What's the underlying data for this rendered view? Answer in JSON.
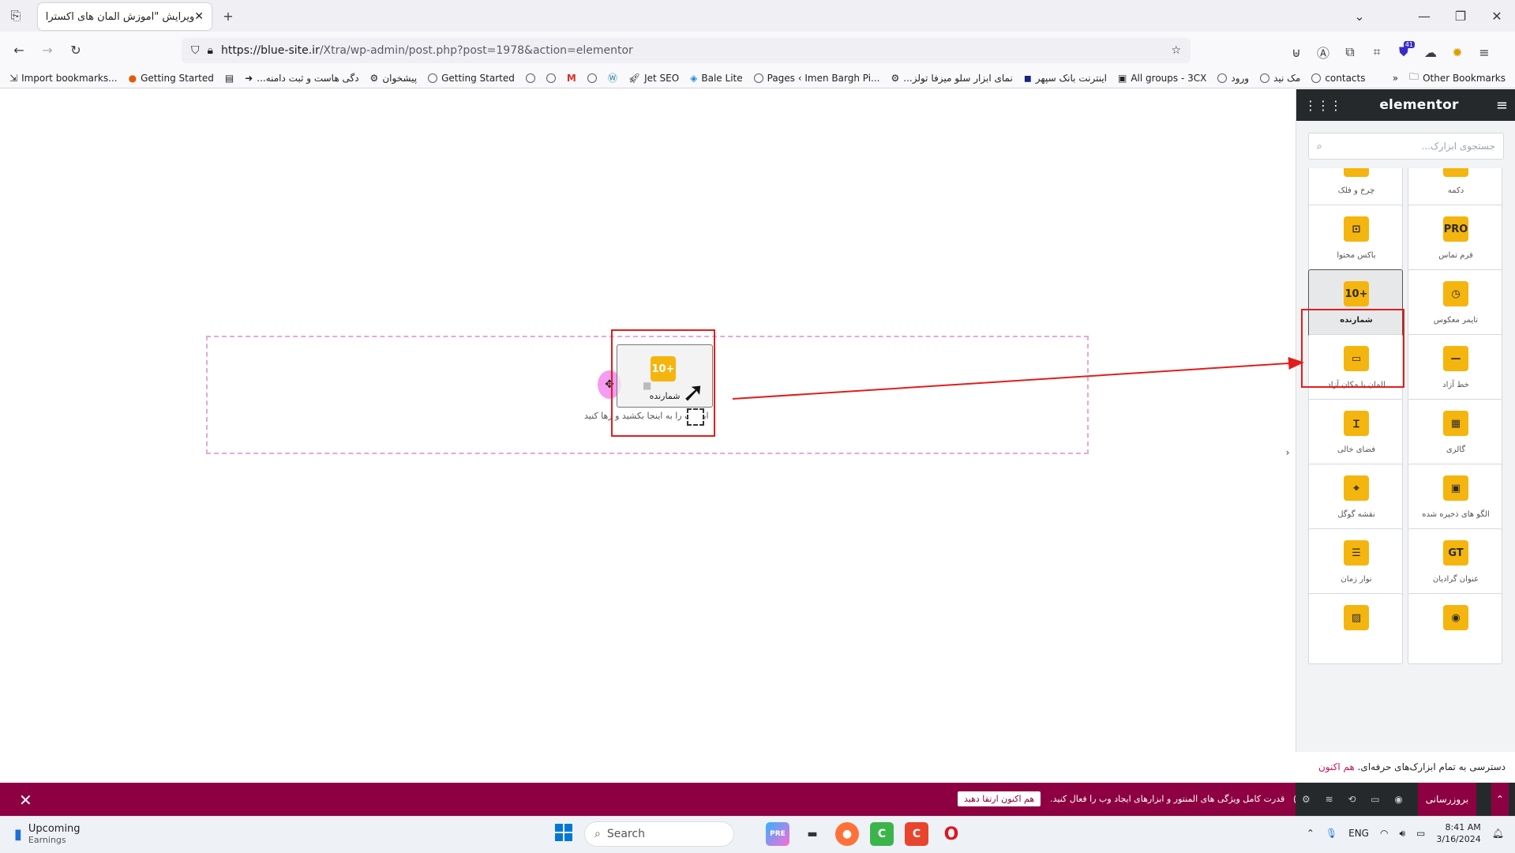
{
  "browser": {
    "tab_title": "ویرایش \"آموزش المان های اکسترا – ...",
    "url_host": "https://blue-site.ir",
    "url_path": "/Xtra/wp-admin/post.php?post=1978&action=elementor",
    "bookmarks": [
      {
        "label": "Import bookmarks...",
        "icon": "import-icon"
      },
      {
        "label": "Getting Started",
        "icon": "firefox-icon"
      },
      {
        "label": "",
        "icon": "calendar-icon"
      },
      {
        "label": "...دگی هاست و ثبت دامنه",
        "icon": "arrow-icon"
      },
      {
        "label": "پیشخوان",
        "icon": "gear-icon"
      },
      {
        "label": "Getting Started",
        "icon": "globe-icon"
      },
      {
        "label": "",
        "icon": "globe-icon"
      },
      {
        "label": "",
        "icon": "globe-icon"
      },
      {
        "label": "",
        "icon": "gmail-icon"
      },
      {
        "label": "",
        "icon": "globe-icon"
      },
      {
        "label": "",
        "icon": "wordpress-icon"
      },
      {
        "label": "Jet SEO",
        "icon": "rocket-icon"
      },
      {
        "label": "Bale Lite",
        "icon": "bale-icon"
      },
      {
        "label": "Pages ‹ Imen Bargh Pi...",
        "icon": "globe-icon"
      },
      {
        "label": "...نمای ابزار سلو میزفا تولز",
        "icon": "gear-icon"
      },
      {
        "label": "اینترنت بانک سپهر",
        "icon": "bank-icon"
      },
      {
        "label": "All groups - 3CX",
        "icon": "3cx-icon"
      },
      {
        "label": "ورود",
        "icon": "globe-icon"
      },
      {
        "label": "مک نید",
        "icon": "globe-icon"
      },
      {
        "label": "contacts",
        "icon": "globe-icon"
      }
    ],
    "other_bookmarks": "Other Bookmarks",
    "extension_badge": "41"
  },
  "canvas": {
    "dropzone_hint": "ابزارک را به اینجا بکشید و رها کنید",
    "dragged_widget": {
      "icon_text": "10+",
      "label": "شمارنده"
    }
  },
  "panel": {
    "logo": "elementor",
    "search_placeholder": "جستجوی ابزارک...",
    "widgets": [
      {
        "label": "چرخ و فلک",
        "icon": "code-icon",
        "glyph": "‹›"
      },
      {
        "label": "دکمه",
        "icon": "button-icon",
        "glyph": "▭"
      },
      {
        "label": "باکس محتوا",
        "icon": "content-box-icon",
        "glyph": "⊡"
      },
      {
        "label": "فرم تماس",
        "icon": "form-pro-icon",
        "glyph": "PRO"
      },
      {
        "label": "شمارنده",
        "icon": "counter-icon",
        "glyph": "10+"
      },
      {
        "label": "تایمر معکوس",
        "icon": "timer-icon",
        "glyph": "◷"
      },
      {
        "label": "المان با مکان آزاد",
        "icon": "free-element-icon",
        "glyph": "▭"
      },
      {
        "label": "خط آزاد",
        "icon": "divider-icon",
        "glyph": "—"
      },
      {
        "label": "فضای خالی",
        "icon": "spacer-icon",
        "glyph": "Ɪ"
      },
      {
        "label": "گالری",
        "icon": "gallery-icon",
        "glyph": "▦"
      },
      {
        "label": "نقشه گوگل",
        "icon": "map-pin-icon",
        "glyph": "⌖"
      },
      {
        "label": "الگو های ذخیره شده",
        "icon": "template-icon",
        "glyph": "▣"
      },
      {
        "label": "نوار زمان",
        "icon": "timeline-icon",
        "glyph": "☰"
      },
      {
        "label": "عنوان گرادیان",
        "icon": "gradient-title-icon",
        "glyph": "GT"
      },
      {
        "label": "",
        "icon": "image-icon",
        "glyph": "▨"
      },
      {
        "label": "",
        "icon": "target-icon",
        "glyph": "◉"
      }
    ],
    "promo_text": "دسترسی به تمام ابزارک‌های حرفه‌ای.",
    "promo_link": "هم اکنون ارتقا دهید",
    "publish_label": "بروزرسانی"
  },
  "bottombar": {
    "promo": "قدرت کامل ویژگی های المنتور و ابزارهای ایجاد وب را فعال کنید.",
    "upgrade_button": "هم اکنون ارتقا دهید"
  },
  "taskbar": {
    "weather_title": "Upcoming",
    "weather_sub": "Earnings",
    "search_label": "Search",
    "language": "ENG",
    "time": "8:41 AM",
    "date": "3/16/2024"
  },
  "colors": {
    "elementor_accent": "#8d0041",
    "widget_icon_bg": "#f5b50f",
    "highlight_red": "#e31c1c"
  }
}
